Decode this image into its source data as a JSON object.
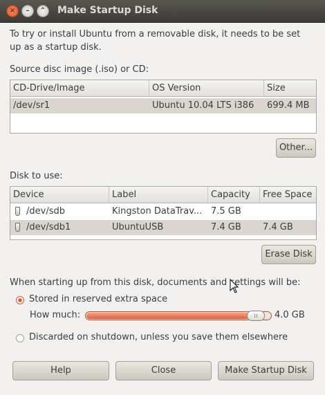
{
  "window": {
    "title": "Make Startup Disk",
    "close_glyph": "×",
    "min_glyph": "–",
    "max_glyph": "⌃"
  },
  "intro": "To try or install Ubuntu from a removable disk, it needs to be set up as a startup disk.",
  "source": {
    "label": "Source disc image (.iso) or CD:",
    "columns": [
      "CD-Drive/Image",
      "OS Version",
      "Size"
    ],
    "rows": [
      {
        "image": "/dev/sr1",
        "os": "Ubuntu 10.04 LTS i386",
        "size": "699.4 MB"
      }
    ],
    "other_button": "Other..."
  },
  "disk": {
    "label": "Disk to use:",
    "columns": [
      "Device",
      "Label",
      "Capacity",
      "Free Space"
    ],
    "rows": [
      {
        "device": "/dev/sdb",
        "label": "Kingston DataTrav...",
        "capacity": "7.5 GB",
        "free": ""
      },
      {
        "device": "/dev/sdb1",
        "label": "UbuntuUSB",
        "capacity": "7.4 GB",
        "free": "7.4 GB"
      }
    ],
    "erase_button": "Erase Disk"
  },
  "startup": {
    "label": "When starting up from this disk, documents and settings will be:",
    "option_stored": "Stored in reserved extra space",
    "how_much_label": "How much:",
    "how_much_value": "4.0 GB",
    "slider_fraction": 0.96,
    "option_discarded": "Discarded on shutdown, unless you save them elsewhere",
    "selected": "stored"
  },
  "buttons": {
    "help": "Help",
    "close": "Close",
    "make": "Make Startup Disk"
  },
  "colors": {
    "accent": "#e9562c",
    "titlebar": "#3c3b37",
    "selection": "#dad6cf"
  }
}
